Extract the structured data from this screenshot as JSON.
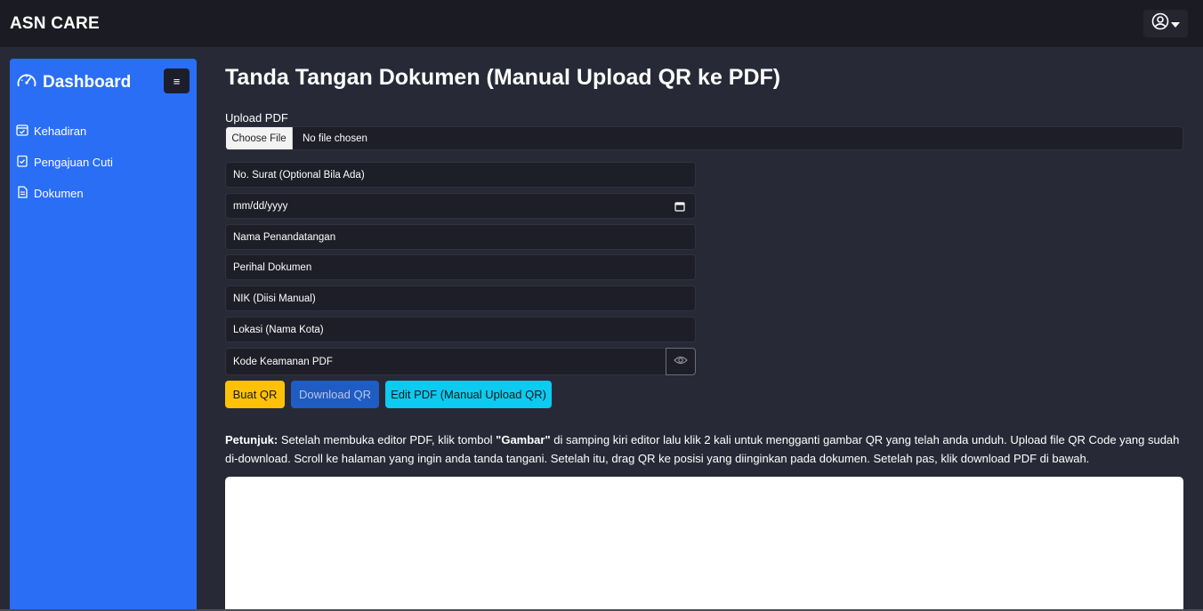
{
  "app": {
    "brand": "ASN CARE"
  },
  "header": {
    "user_icon": "user-circle-icon",
    "caret_icon": "caret-down-icon"
  },
  "sidebar": {
    "title": "Dashboard",
    "title_icon": "speedometer-icon",
    "toggle_label": "≡",
    "items": [
      {
        "label": "Kehadiran",
        "icon": "calendar-check-icon"
      },
      {
        "label": "Pengajuan Cuti",
        "icon": "clipboard-check-icon"
      },
      {
        "label": "Dokumen",
        "icon": "file-text-icon"
      }
    ]
  },
  "main": {
    "title": "Tanda Tangan Dokumen (Manual Upload QR ke PDF)",
    "upload_label": "Upload PDF",
    "file_button": "Choose File",
    "file_status": "No file chosen",
    "fields": {
      "no_surat": "No. Surat (Optional Bila Ada)",
      "date": "mm/dd/yyyy",
      "nama": "Nama Penandatangan",
      "perihal": "Perihal Dokumen",
      "nik": "NIK (Diisi Manual)",
      "lokasi": "Lokasi (Nama Kota)",
      "kode": "Kode Keamanan PDF"
    },
    "buttons": {
      "buat_qr": "Buat QR",
      "download_qr": "Download QR",
      "edit_pdf": "Edit PDF (Manual Upload QR)"
    },
    "instructions": {
      "label": "Petunjuk:",
      "part1": " Setelah membuka editor PDF, klik tombol ",
      "keyword": "\"Gambar\"",
      "part2": " di samping kiri editor lalu klik 2 kali untuk mengganti gambar QR yang telah anda unduh. Upload file QR Code yang sudah di-download. Scroll ke halaman yang ingin anda tanda tangani. Setelah itu, drag QR ke posisi yang diinginkan pada dokumen. Setelah pas, klik download PDF di bawah."
    }
  },
  "colors": {
    "background": "#272a36",
    "topbar": "#1b1c23",
    "sidebar": "#2a6ef5",
    "warning": "#ffc107",
    "primary": "#1f5cc4",
    "info": "#0dcaf0"
  }
}
